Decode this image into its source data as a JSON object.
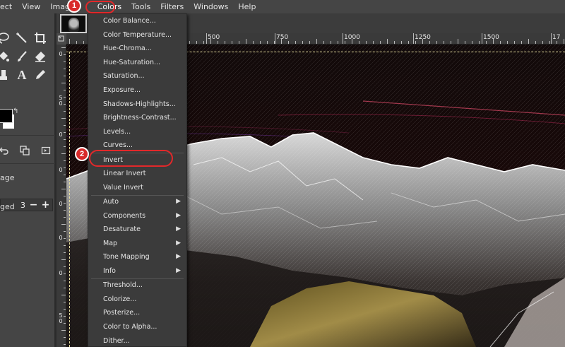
{
  "menubar": {
    "items": [
      "ect",
      "View",
      "Image",
      "Colors",
      "Tools",
      "Filters",
      "Windows",
      "Help"
    ]
  },
  "toolbox": {
    "image_label": "age",
    "stepper_value": "3",
    "stepper_minus": "−",
    "stepper_plus": "+",
    "merged_label": "ged"
  },
  "ruler": {
    "h_labels": [
      "500",
      "750",
      "1000",
      "1250",
      "1500",
      "17"
    ],
    "v_labels": [
      "0",
      "5",
      "0",
      "0",
      "0",
      "0",
      "0",
      "0",
      "5",
      "0"
    ]
  },
  "colors_menu": {
    "group1": [
      "Color Balance...",
      "Color Temperature...",
      "Hue-Chroma...",
      "Hue-Saturation...",
      "Saturation...",
      "Exposure...",
      "Shadows-Highlights...",
      "Brightness-Contrast...",
      "Levels...",
      "Curves..."
    ],
    "group2": [
      "Invert",
      "Linear Invert",
      "Value Invert"
    ],
    "group3": [
      "Auto",
      "Components",
      "Desaturate",
      "Map",
      "Tone Mapping",
      "Info"
    ],
    "group4": [
      "Threshold...",
      "Colorize...",
      "Posterize...",
      "Color to Alpha...",
      "Dither..."
    ]
  },
  "annotations": {
    "step1": "1",
    "step2": "2"
  },
  "colors": {
    "accent_red": "#e3282a",
    "menu_bg": "#3b3b3b",
    "panel_bg": "#454545"
  }
}
